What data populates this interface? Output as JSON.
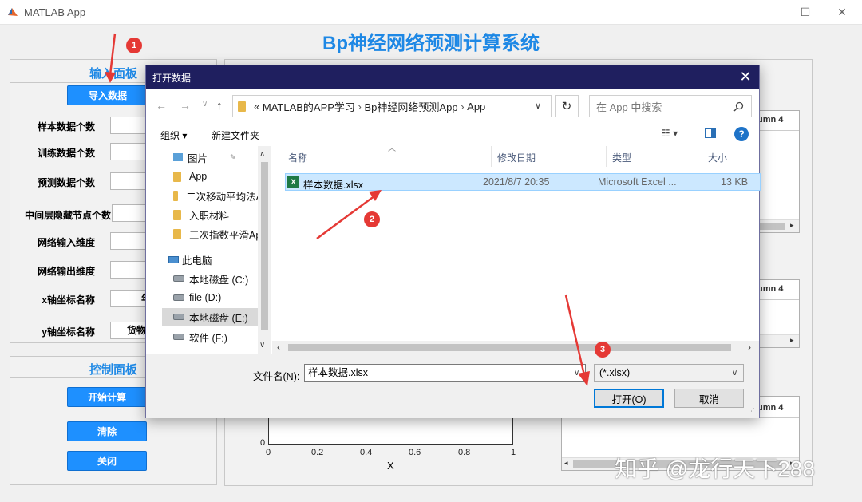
{
  "window": {
    "title": "MATLAB App",
    "minimize": "—",
    "maximize": "☐",
    "close": "✕"
  },
  "app": {
    "title": "Bp神经网络预测计算系统",
    "input_panel": {
      "title": "输入面板",
      "import_button": "导入数据",
      "fields": [
        {
          "label": "样本数据个数",
          "value": ""
        },
        {
          "label": "训练数据个数",
          "value": ""
        },
        {
          "label": "预测数据个数",
          "value": ""
        },
        {
          "label": "中间层隐藏节点个数",
          "value": ""
        },
        {
          "label": "网络输入维度",
          "value": ""
        },
        {
          "label": "网络输出维度",
          "value": ""
        },
        {
          "label": "x轴坐标名称",
          "value": "年"
        },
        {
          "label": "y轴坐标名称",
          "value": "货物"
        }
      ]
    },
    "control_panel": {
      "title": "控制面板",
      "start_button": "开始计算",
      "clear_button": "清除",
      "close_button": "关闭"
    },
    "tables": [
      {
        "col_header": "umn 4"
      },
      {
        "col_header": "umn 4"
      },
      {
        "col_header": "umn 4"
      }
    ],
    "plot": {
      "xlabel": "X",
      "y_zero_tick": "0",
      "x_ticks": [
        "0",
        "0.2",
        "0.4",
        "0.6",
        "0.8",
        "1"
      ]
    }
  },
  "dialog": {
    "title": "打开数据",
    "close": "✕",
    "nav": {
      "back": "←",
      "forward": "→",
      "dropdown": "∨",
      "up": "↑"
    },
    "address": {
      "prefix": "«",
      "segments": [
        "MATLAB的APP学习",
        "Bp神经网络预测App",
        "App"
      ],
      "separator": "›",
      "dropdown": "∨"
    },
    "refresh": "↻",
    "search_placeholder": "在 App 中搜索",
    "toolbar": {
      "organize": "组织 ▾",
      "new_folder": "新建文件夹",
      "view": "☷ ▾"
    },
    "nav_pane": {
      "items": [
        {
          "label": "图片",
          "icon": "picture-icon",
          "pin": "📌"
        },
        {
          "label": "App",
          "icon": "folder-icon"
        },
        {
          "label": "二次移动平均法A",
          "icon": "folder-icon"
        },
        {
          "label": "入职材料",
          "icon": "folder-icon"
        },
        {
          "label": "三次指数平滑Ap",
          "icon": "folder-icon"
        },
        {
          "label": "此电脑",
          "icon": "computer-icon"
        },
        {
          "label": "本地磁盘 (C:)",
          "icon": "drive-icon"
        },
        {
          "label": "file (D:)",
          "icon": "drive-icon"
        },
        {
          "label": "本地磁盘 (E:)",
          "icon": "drive-icon"
        },
        {
          "label": "软件 (F:)",
          "icon": "drive-icon"
        }
      ]
    },
    "columns": {
      "name": "名称",
      "modified": "修改日期",
      "type": "类型",
      "size": "大小"
    },
    "files": [
      {
        "name": "样本数据.xlsx",
        "modified": "2021/8/7 20:35",
        "type": "Microsoft Excel ...",
        "size": "13 KB"
      }
    ],
    "filename_label": "文件名(N):",
    "filename_value": "样本数据.xlsx",
    "filter": "(*.xlsx)",
    "open_button": "打开(O)",
    "cancel_button": "取消"
  },
  "annotations": {
    "badge1": "1",
    "badge2": "2",
    "badge3": "3"
  },
  "watermark": "知乎 @龙行天下288"
}
